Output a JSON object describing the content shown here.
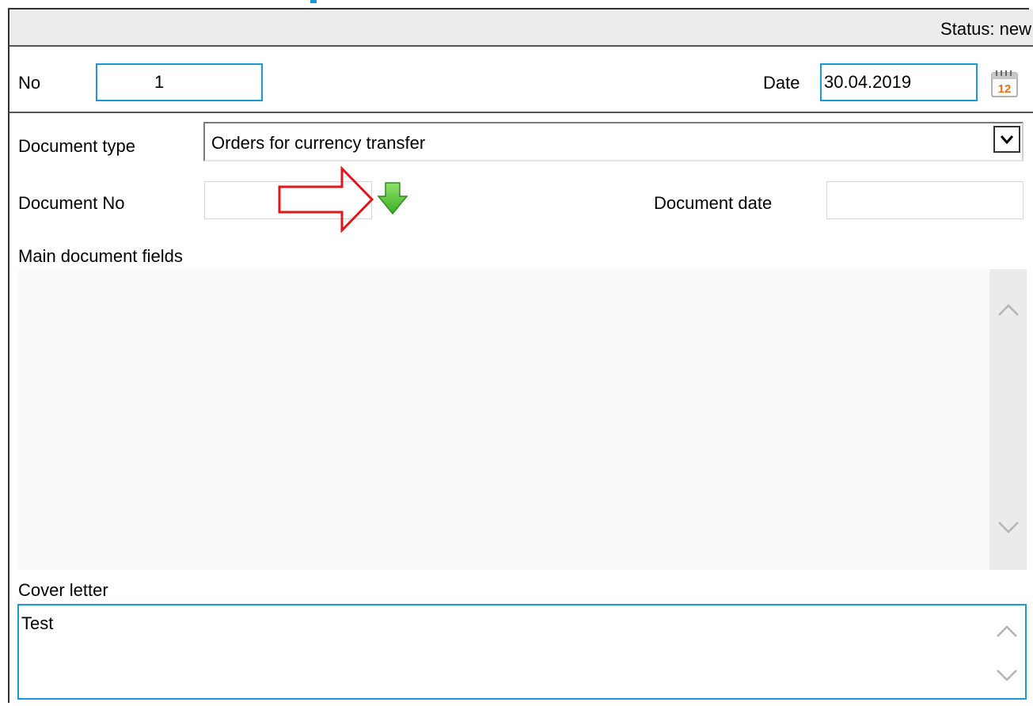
{
  "status": {
    "text": "Status: new"
  },
  "header": {
    "no_label": "No",
    "no_value": "1",
    "date_label": "Date",
    "date_value": "30.04.2019",
    "calendar_icon": "calendar-icon"
  },
  "document_type": {
    "label": "Document type",
    "selected": "Orders for currency transfer",
    "dropdown_icon": "chevron-down-icon"
  },
  "document_no": {
    "label": "Document No",
    "value": "",
    "fill_icon": "green-down-arrow-icon",
    "annotation_icon": "red-outline-arrow-icon"
  },
  "document_date": {
    "label": "Document date",
    "value": ""
  },
  "main_fields": {
    "label": "Main document fields"
  },
  "cover_letter": {
    "label": "Cover letter",
    "value": "Test"
  },
  "colors": {
    "accent": "#1a9ad6",
    "annotation": "#e0161b",
    "fill_arrow": "#5cc33b"
  }
}
